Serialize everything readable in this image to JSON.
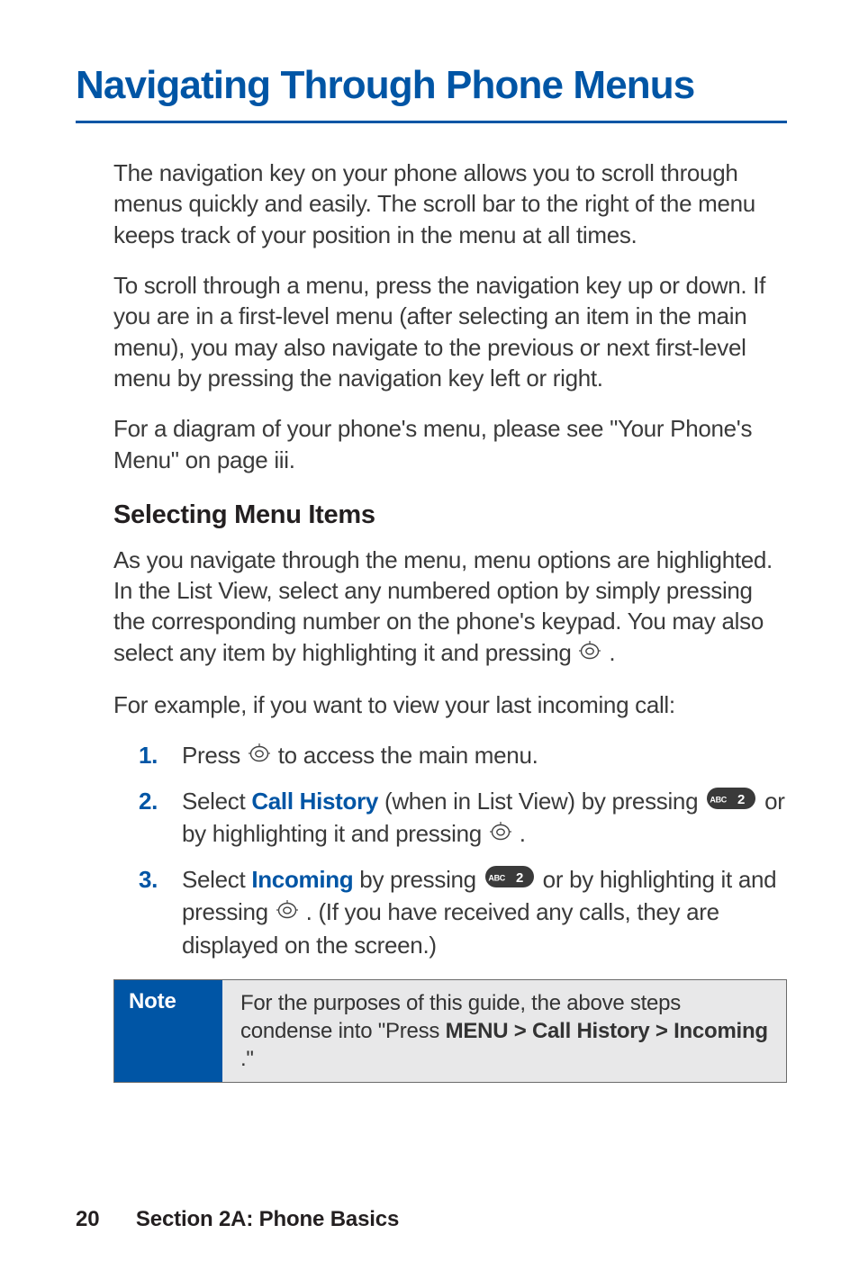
{
  "title": "Navigating Through Phone Menus",
  "para1": "The navigation key on your phone allows you to scroll through menus quickly and easily. The scroll bar to the right of the menu keeps track of your position in the menu at all times.",
  "para2": "To scroll through a menu, press the navigation key up or down. If you are in a first-level menu (after selecting an item in the main menu), you may also navigate to the previous or next first-level menu by pressing the navigation key left or right.",
  "para3": "For a diagram of your phone's menu, please see \"Your Phone's Menu\" on page iii.",
  "subhead": "Selecting Menu Items",
  "para4_a": "As you navigate through the menu, menu options are highlighted. In the List View, select any numbered option by simply pressing the corresponding number on the phone's keypad. You may also select any item by highlighting it and pressing ",
  "para4_b": " .",
  "para5": "For example, if you want to view your last incoming call:",
  "steps": {
    "s1_num": "1.",
    "s1_a": "Press ",
    "s1_b": " to access the main menu.",
    "s2_num": "2.",
    "s2_a": "Select ",
    "s2_bold": "Call History",
    "s2_b": " (when in List View) by pressing ",
    "s2_c": "  or by highlighting it and pressing ",
    "s2_d": " .",
    "s3_num": "3.",
    "s3_a": "Select ",
    "s3_bold": "Incoming",
    "s3_b": " by pressing ",
    "s3_c": " or by highlighting it and pressing ",
    "s3_d": " . (If you have received any calls, they are displayed on the screen.)"
  },
  "note": {
    "label": "Note",
    "body_a": "For the purposes of this guide, the above steps condense into \"Press ",
    "body_bold": "MENU > Call History > Incoming",
    "body_b": ".\""
  },
  "footer": {
    "page_number": "20",
    "section": "Section 2A: Phone Basics"
  },
  "key_label": "ABC 2"
}
